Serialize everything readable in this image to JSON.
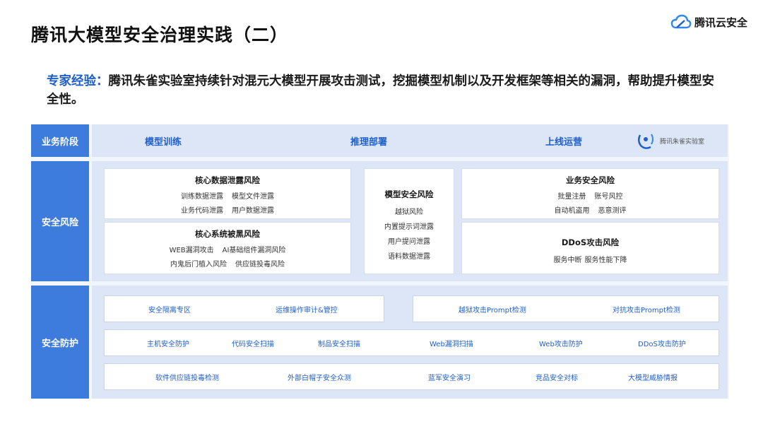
{
  "title": "腾讯大模型安全治理实践（二）",
  "logo": {
    "text": "腾讯云安全",
    "icon": "cloud-logo-icon"
  },
  "intro": {
    "label": "专家经验：",
    "text": "腾讯朱雀实验室持续针对混元大模型开展攻击测试，挖掘模型机制以及开发框架等相关的漏洞，帮助提升模型安全性。"
  },
  "framework": {
    "labels": {
      "stage": "业务阶段",
      "risk": "安全风险",
      "defense": "安全防护"
    },
    "stages": [
      "模型训练",
      "推理部署",
      "上线运营"
    ],
    "lab_logo_text": "腾讯朱雀实验室",
    "risks": {
      "core_data": {
        "title": "核心数据泄露风险",
        "line1": [
          "训练数据泄露",
          "模型文件泄露"
        ],
        "line2": [
          "业务代码泄露",
          "用户数据泄露"
        ]
      },
      "core_system": {
        "title": "核心系统被黑风险",
        "line1": [
          "WEB漏洞攻击",
          "AI基础组件漏洞风险"
        ],
        "line2": [
          "内鬼后门植入风险",
          "供应链投毒风险"
        ]
      },
      "model": {
        "title": "模型安全风险",
        "items": [
          "越狱风险",
          "内置提示词泄露",
          "用户提问泄露",
          "语料数据泄露"
        ]
      },
      "business": {
        "title": "业务安全风险",
        "line1": [
          "批量注册",
          "账号风控"
        ],
        "line2": [
          "自动机盗用",
          "恶意测评"
        ]
      },
      "ddos": {
        "title": "DDoS攻击风险",
        "line1": [
          "服务中断",
          "服务性能下降"
        ]
      }
    },
    "defense": {
      "row1a": [
        "安全隔离专区",
        "运维操作审计&管控"
      ],
      "row1b": [
        "越狱攻击Prompt检测",
        "对抗攻击Prompt检测"
      ],
      "row2": [
        "主机安全防护",
        "代码安全扫描",
        "制品安全扫描",
        "Web漏洞扫描",
        "Web攻击防护",
        "DDoS攻击防护"
      ],
      "row3": [
        "软件供应链投毒检测",
        "外部白帽子安全众测",
        "蓝军安全演习",
        "竞品安全对标",
        "大模型威胁情报"
      ]
    }
  }
}
